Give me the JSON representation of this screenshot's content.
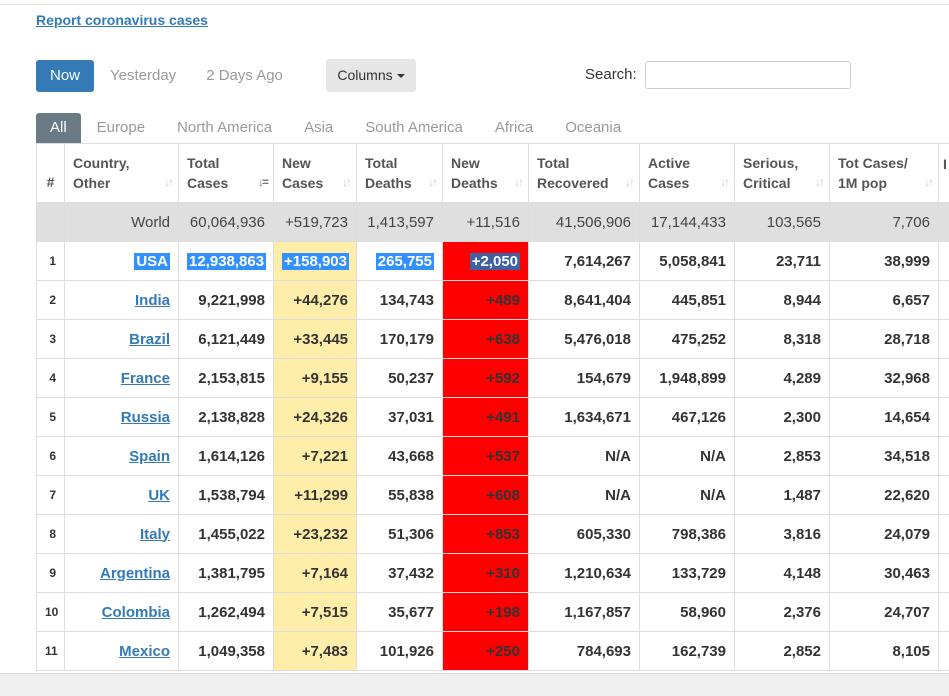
{
  "report_link": "Report coronavirus cases",
  "day_tabs": [
    "Now",
    "Yesterday",
    "2 Days Ago"
  ],
  "columns_button": "Columns",
  "search": {
    "label": "Search:",
    "value": ""
  },
  "region_tabs": [
    "All",
    "Europe",
    "North America",
    "Asia",
    "South America",
    "Africa",
    "Oceania"
  ],
  "headers": {
    "num": "#",
    "country_1": "Country,",
    "country_2": "Other",
    "total_cases_1": "Total",
    "total_cases_2": "Cases",
    "new_cases_1": "New",
    "new_cases_2": "Cases",
    "total_deaths_1": "Total",
    "total_deaths_2": "Deaths",
    "new_deaths_1": "New",
    "new_deaths_2": "Deaths",
    "total_recovered_1": "Total",
    "total_recovered_2": "Recovered",
    "active_cases_1": "Active",
    "active_cases_2": "Cases",
    "serious_1": "Serious,",
    "serious_2": "Critical",
    "tot_per_1m_1": "Tot Cases/",
    "tot_per_1m_2": "1M pop",
    "cut_off": "I"
  },
  "world": {
    "label": "World",
    "total_cases": "60,064,936",
    "new_cases": "+519,723",
    "total_deaths": "1,413,597",
    "new_deaths": "+11,516",
    "total_recovered": "41,506,906",
    "active_cases": "17,144,433",
    "serious": "103,565",
    "tot_per_1m": "7,706"
  },
  "rows": [
    {
      "num": "1",
      "country": "USA",
      "total_cases": "12,938,863",
      "new_cases": "+158,903",
      "total_deaths": "265,755",
      "new_deaths": "+2,050",
      "total_recovered": "7,614,267",
      "active_cases": "5,058,841",
      "serious": "23,711",
      "tot_per_1m": "38,999"
    },
    {
      "num": "2",
      "country": "India",
      "total_cases": "9,221,998",
      "new_cases": "+44,276",
      "total_deaths": "134,743",
      "new_deaths": "+489",
      "total_recovered": "8,641,404",
      "active_cases": "445,851",
      "serious": "8,944",
      "tot_per_1m": "6,657"
    },
    {
      "num": "3",
      "country": "Brazil",
      "total_cases": "6,121,449",
      "new_cases": "+33,445",
      "total_deaths": "170,179",
      "new_deaths": "+638",
      "total_recovered": "5,476,018",
      "active_cases": "475,252",
      "serious": "8,318",
      "tot_per_1m": "28,718"
    },
    {
      "num": "4",
      "country": "France",
      "total_cases": "2,153,815",
      "new_cases": "+9,155",
      "total_deaths": "50,237",
      "new_deaths": "+592",
      "total_recovered": "154,679",
      "active_cases": "1,948,899",
      "serious": "4,289",
      "tot_per_1m": "32,968"
    },
    {
      "num": "5",
      "country": "Russia",
      "total_cases": "2,138,828",
      "new_cases": "+24,326",
      "total_deaths": "37,031",
      "new_deaths": "+491",
      "total_recovered": "1,634,671",
      "active_cases": "467,126",
      "serious": "2,300",
      "tot_per_1m": "14,654"
    },
    {
      "num": "6",
      "country": "Spain",
      "total_cases": "1,614,126",
      "new_cases": "+7,221",
      "total_deaths": "43,668",
      "new_deaths": "+537",
      "total_recovered": "N/A",
      "active_cases": "N/A",
      "serious": "2,853",
      "tot_per_1m": "34,518"
    },
    {
      "num": "7",
      "country": "UK",
      "total_cases": "1,538,794",
      "new_cases": "+11,299",
      "total_deaths": "55,838",
      "new_deaths": "+608",
      "total_recovered": "N/A",
      "active_cases": "N/A",
      "serious": "1,487",
      "tot_per_1m": "22,620"
    },
    {
      "num": "8",
      "country": "Italy",
      "total_cases": "1,455,022",
      "new_cases": "+23,232",
      "total_deaths": "51,306",
      "new_deaths": "+853",
      "total_recovered": "605,330",
      "active_cases": "798,386",
      "serious": "3,816",
      "tot_per_1m": "24,079"
    },
    {
      "num": "9",
      "country": "Argentina",
      "total_cases": "1,381,795",
      "new_cases": "+7,164",
      "total_deaths": "37,432",
      "new_deaths": "+310",
      "total_recovered": "1,210,634",
      "active_cases": "133,729",
      "serious": "4,148",
      "tot_per_1m": "30,463"
    },
    {
      "num": "10",
      "country": "Colombia",
      "total_cases": "1,262,494",
      "new_cases": "+7,515",
      "total_deaths": "35,677",
      "new_deaths": "+198",
      "total_recovered": "1,167,857",
      "active_cases": "58,960",
      "serious": "2,376",
      "tot_per_1m": "24,707"
    },
    {
      "num": "11",
      "country": "Mexico",
      "total_cases": "1,049,358",
      "new_cases": "+7,483",
      "total_deaths": "101,926",
      "new_deaths": "+250",
      "total_recovered": "784,693",
      "active_cases": "162,739",
      "serious": "2,852",
      "tot_per_1m": "8,105"
    }
  ],
  "colors": {
    "accent": "#337ab7",
    "new_cases_bg": "#ffeeaa",
    "new_deaths_bg": "#ff0000",
    "world_row_bg": "#dfdfdf",
    "selection": "#3390ff"
  },
  "icons": {
    "sort": "sort-arrows-icon",
    "caret": "caret-down-icon"
  }
}
